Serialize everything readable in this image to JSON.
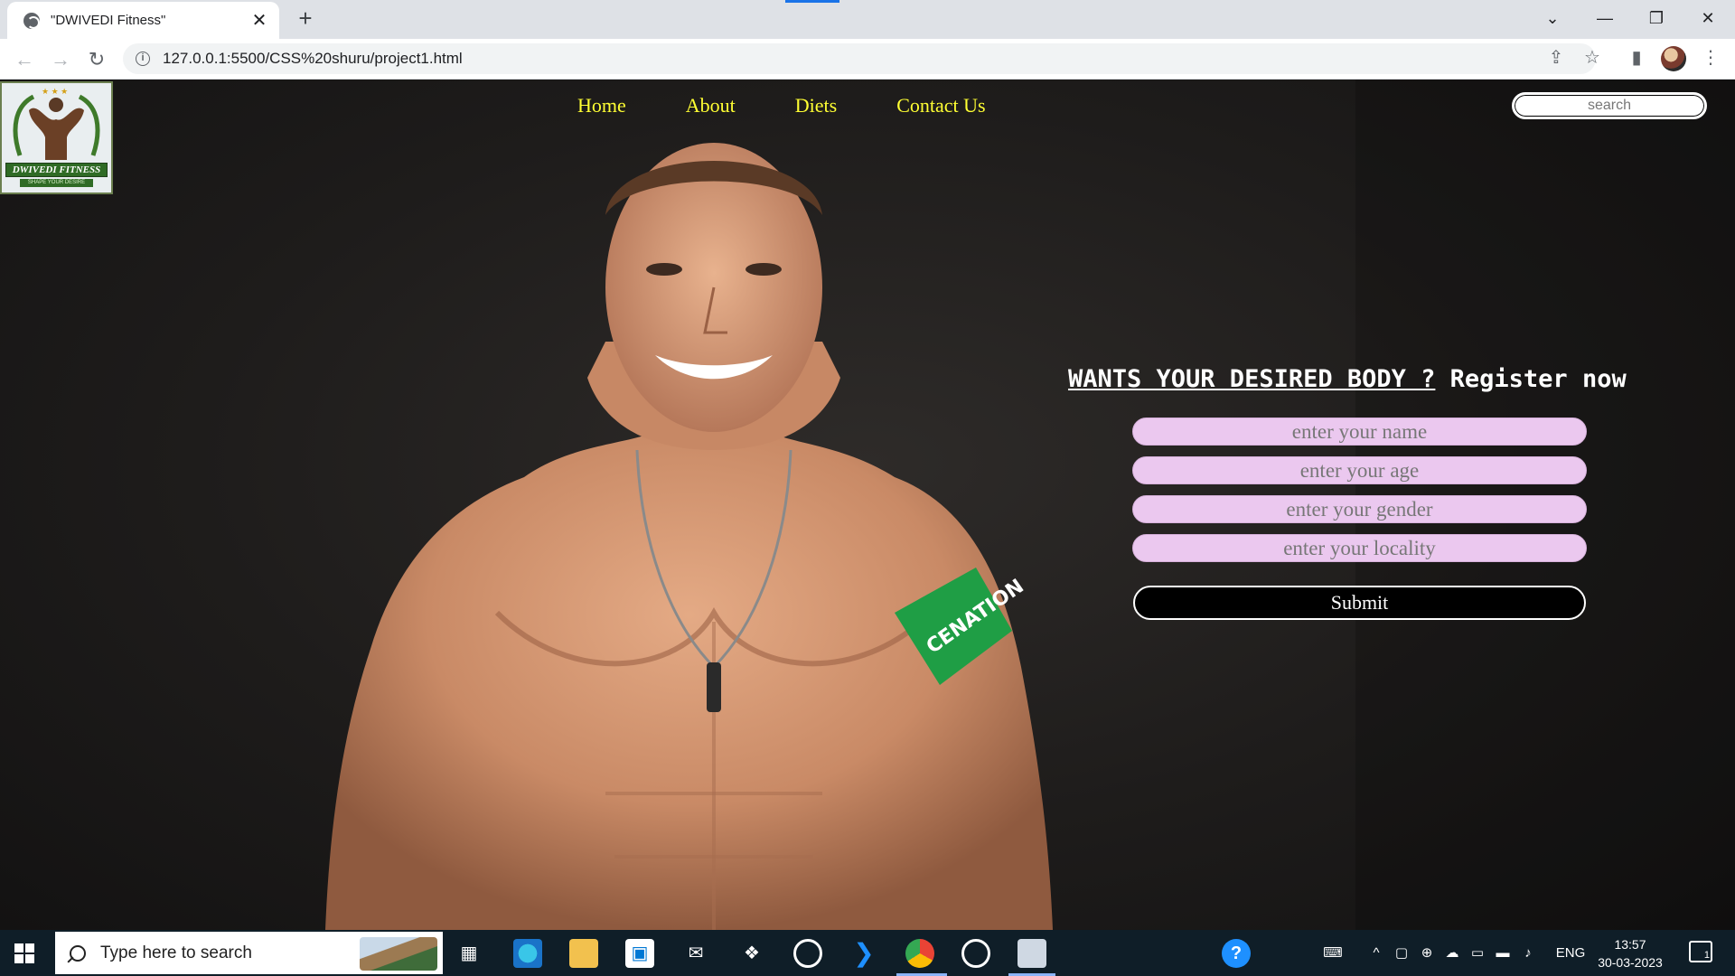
{
  "browser": {
    "tab_title": "\"DWIVEDI Fitness\"",
    "tab_close": "✕",
    "new_tab": "+",
    "url": "127.0.0.1:5500/CSS%20shuru/project1.html",
    "back": "←",
    "forward": "→",
    "reload": "↻",
    "share": "⇪",
    "bookmark": "☆",
    "sidepanel": "▮",
    "menu": "⋮",
    "chevron": "⌄",
    "minimize": "—",
    "restore": "❐",
    "close": "✕"
  },
  "site": {
    "logo_text": "DWIVEDI FITNESS",
    "logo_sub": "SHAPE YOUR DESIRE",
    "nav": [
      "Home",
      "About",
      "Diets",
      "Contact Us"
    ],
    "search_placeholder": "search",
    "register_underlined": "WANTS YOUR DESIRED BODY ?",
    "register_rest": " Register now",
    "fields": [
      "enter your name",
      "enter your age",
      "enter your gender",
      "enter your locality"
    ],
    "submit_label": "Submit"
  },
  "taskbar": {
    "search_text": "Type here to search",
    "language": "ENG",
    "time": "13:57",
    "date": "30-03-2023",
    "notification_count": "1"
  },
  "colors": {
    "nav_link": "#ffff33",
    "field_bg": "#ebc8ef",
    "taskbar_bg": "#0f1e28"
  }
}
